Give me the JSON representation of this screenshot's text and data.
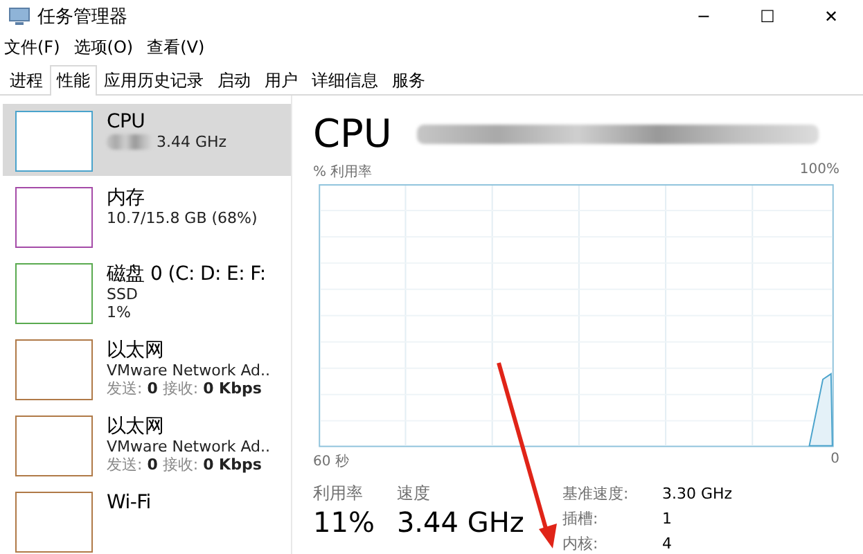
{
  "window": {
    "title": "任务管理器",
    "controls": [
      "─",
      "☐",
      "✕"
    ]
  },
  "menu": [
    "文件(F)",
    "选项(O)",
    "查看(V)"
  ],
  "tabs": [
    {
      "label": "进程",
      "selected": false
    },
    {
      "label": "性能",
      "selected": true
    },
    {
      "label": "应用历史记录",
      "selected": false
    },
    {
      "label": "启动",
      "selected": false
    },
    {
      "label": "用户",
      "selected": false
    },
    {
      "label": "详细信息",
      "selected": false
    },
    {
      "label": "服务",
      "selected": false
    }
  ],
  "sidebar": {
    "items": [
      {
        "title": "CPU",
        "lines": [
          "3.44 GHz"
        ],
        "redacted": true,
        "color": "#4aa3cc",
        "selected": true
      },
      {
        "title": "内存",
        "lines": [
          "10.7/15.8 GB (68%)"
        ],
        "redacted": false,
        "color": "#a54ca8",
        "selected": false
      },
      {
        "title": "磁盘 0 (C: D: E: F:",
        "lines": [
          "SSD",
          "1%"
        ],
        "redacted": false,
        "color": "#5aaa50",
        "selected": false
      },
      {
        "title": "以太网",
        "lines": [
          "VMware Network Ad..",
          "发送: **0** 接收: **0 Kbps**"
        ],
        "redacted": false,
        "color": "#b07a48",
        "selected": false
      },
      {
        "title": "以太网",
        "lines": [
          "VMware Network Ad..",
          "发送: **0** 接收: **0 Kbps**"
        ],
        "redacted": false,
        "color": "#b07a48",
        "selected": false
      },
      {
        "title": "Wi-Fi",
        "redacted": false,
        "color": "#b07a48",
        "selected": false
      }
    ]
  },
  "detail": {
    "title": "CPU",
    "title_redacted": true,
    "graph": {
      "ylabel": "% 利用率",
      "ymax": "100%",
      "xlabel": "60 秒",
      "xmin": "0"
    },
    "stats": [
      {
        "label": "利用率",
        "value": "11%"
      },
      {
        "label": "速度",
        "value": "3.44 GHz"
      }
    ],
    "specs": [
      {
        "label": "基准速度:",
        "value": "3.30 GHz"
      },
      {
        "label": "插槽:",
        "value": "1"
      },
      {
        "label": "内核:",
        "value": "4"
      }
    ]
  }
}
